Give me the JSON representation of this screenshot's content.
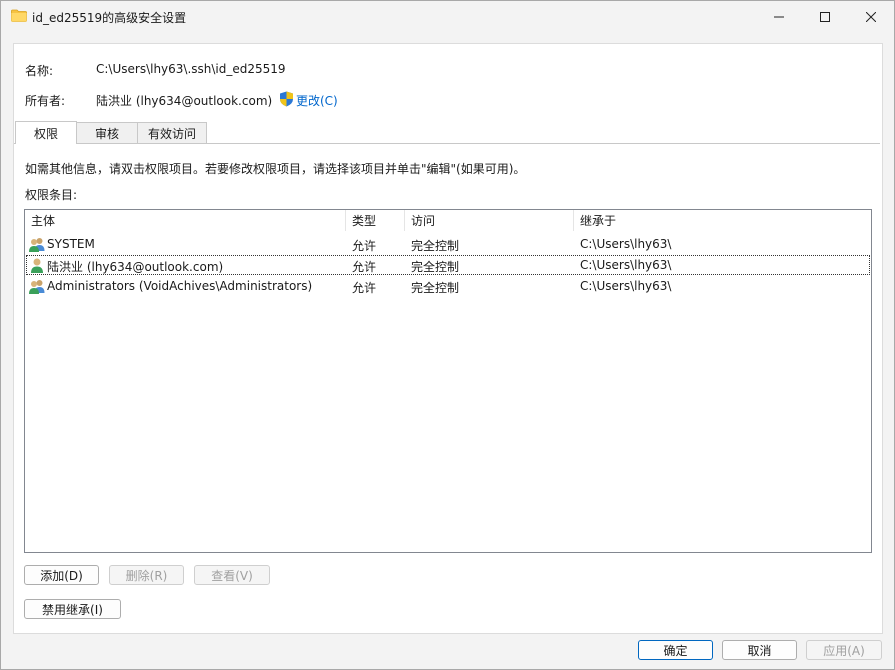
{
  "window": {
    "title": "id_ed25519的高级安全设置"
  },
  "info": {
    "name_label": "名称:",
    "name_value": "C:\\Users\\lhy63\\.ssh\\id_ed25519",
    "owner_label": "所有者:",
    "owner_value": "陆洪业 (lhy634@outlook.com)",
    "change_link": "更改(C)"
  },
  "tabs": [
    {
      "label": "权限",
      "active": true
    },
    {
      "label": "审核",
      "active": false
    },
    {
      "label": "有效访问",
      "active": false
    }
  ],
  "permissions": {
    "instructions": "如需其他信息，请双击权限项目。若要修改权限项目，请选择该项目并单击\"编辑\"(如果可用)。",
    "entries_label": "权限条目:",
    "columns": [
      "主体",
      "类型",
      "访问",
      "继承于"
    ],
    "rows": [
      {
        "principal": "SYSTEM",
        "type": "允许",
        "access": "完全控制",
        "inherited_from": "C:\\Users\\lhy63\\",
        "icon": "group-users-icon"
      },
      {
        "principal": "陆洪业 (lhy634@outlook.com)",
        "type": "允许",
        "access": "完全控制",
        "inherited_from": "C:\\Users\\lhy63\\",
        "icon": "user-icon"
      },
      {
        "principal": "Administrators (VoidAchives\\Administrators)",
        "type": "允许",
        "access": "完全控制",
        "inherited_from": "C:\\Users\\lhy63\\",
        "icon": "group-users-icon"
      }
    ]
  },
  "actions": {
    "add": "添加(D)",
    "remove": "删除(R)",
    "view": "查看(V)",
    "disable_inheritance": "禁用继承(I)"
  },
  "footer": {
    "ok": "确定",
    "cancel": "取消",
    "apply": "应用(A)"
  },
  "colors": {
    "link": "#0066cc",
    "accent": "#0067c0",
    "folder": "#f6c343"
  }
}
